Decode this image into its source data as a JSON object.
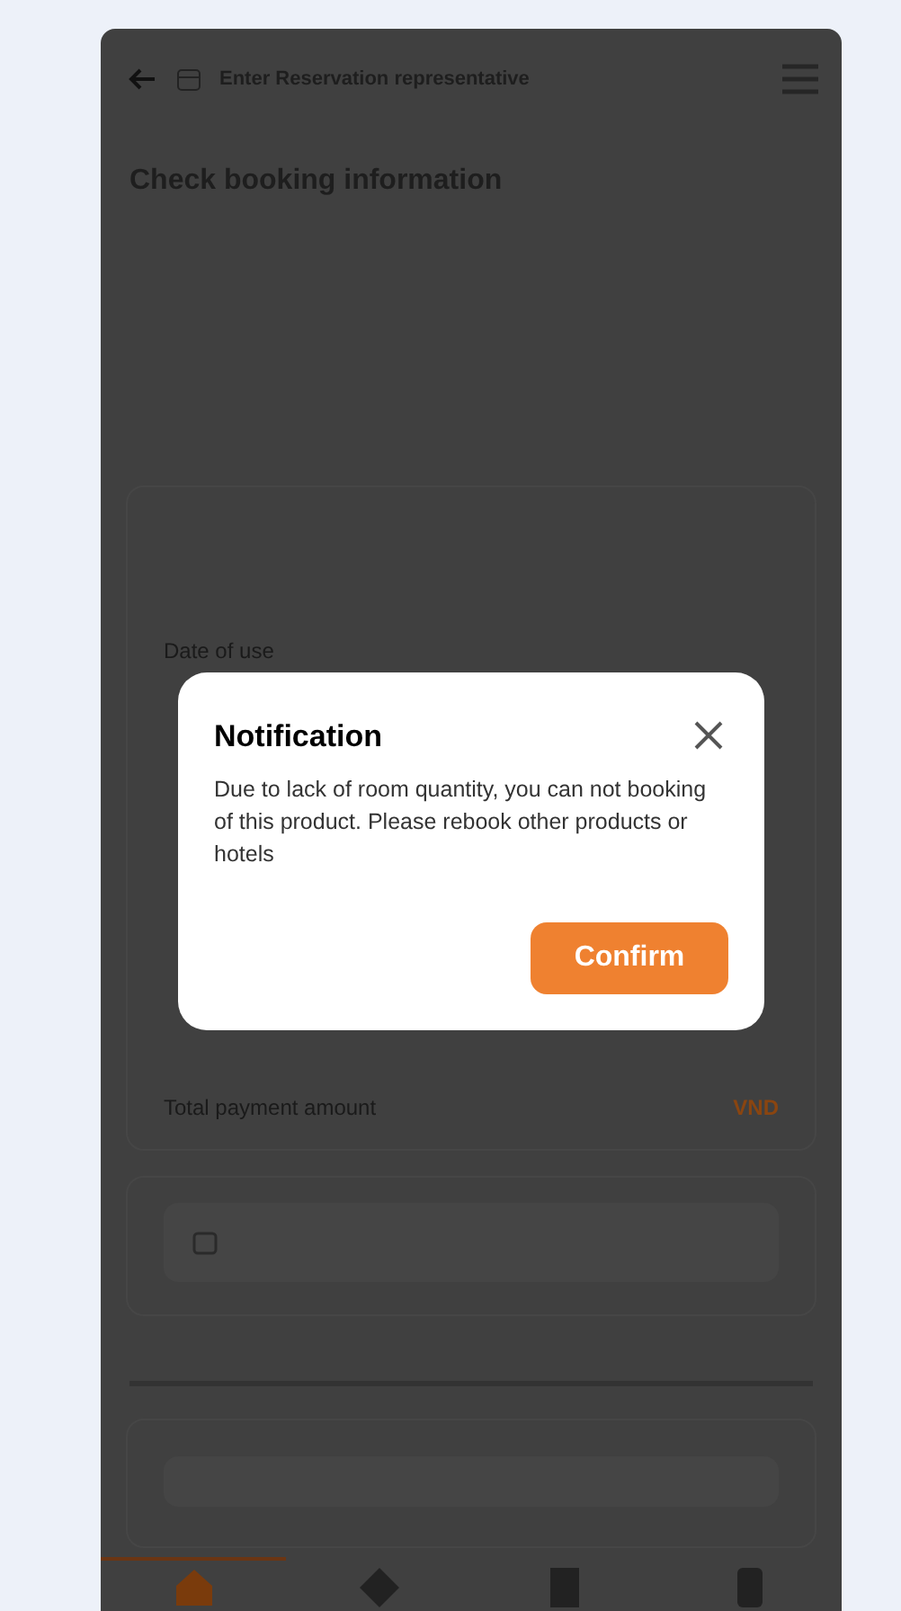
{
  "header": {
    "title": "Enter Reservation representative"
  },
  "page_title": "Check booking information",
  "booking_card": {
    "date_label": "Date of use",
    "total_label": "Total payment amount",
    "total_value": "VND"
  },
  "bottom_nav": [
    {
      "selected": true
    },
    {
      "selected": false
    },
    {
      "selected": false
    },
    {
      "selected": false
    }
  ],
  "dialog": {
    "title": "Notification",
    "message": "Due to lack of room quantity, you can not booking of this product. Please rebook other products or hotels",
    "confirm": "Confirm"
  }
}
